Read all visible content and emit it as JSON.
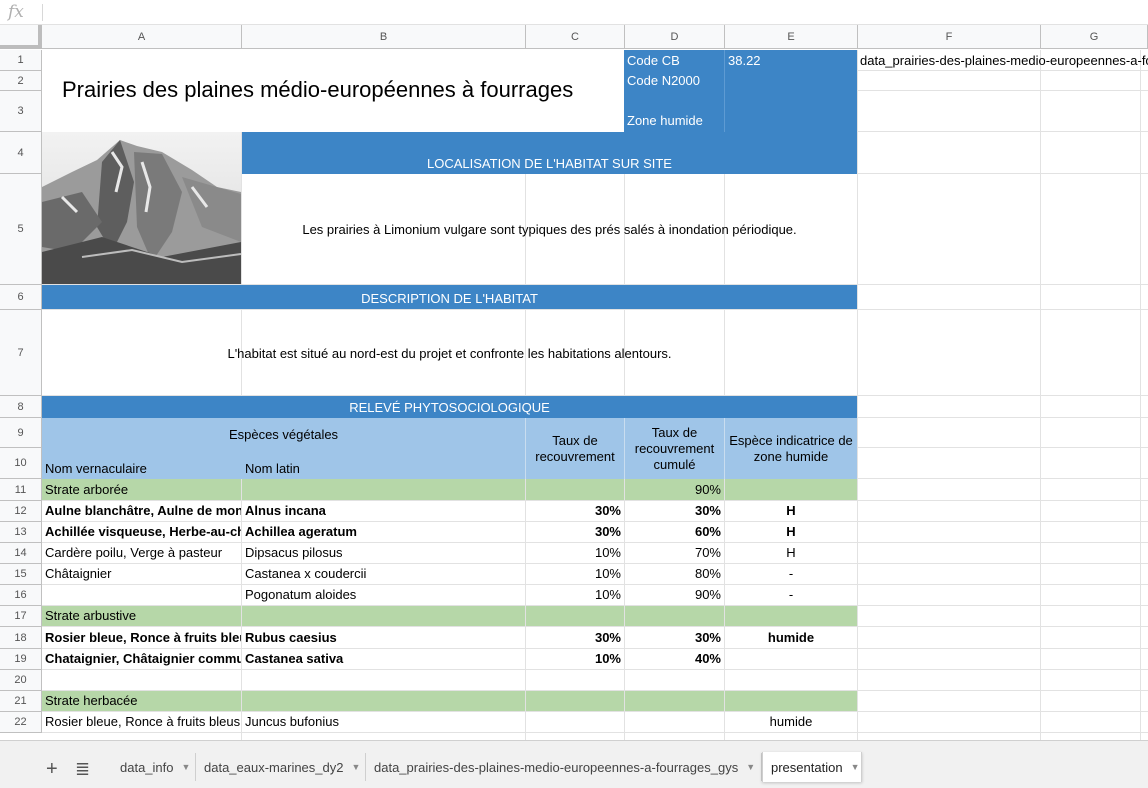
{
  "formula_bar": {
    "fx_label": "fx",
    "value": ""
  },
  "columns": [
    "A",
    "B",
    "C",
    "D",
    "E",
    "F",
    "G"
  ],
  "rows": [
    "1",
    "2",
    "3",
    "4",
    "5",
    "6",
    "7",
    "8",
    "9",
    "10",
    "11",
    "12",
    "13",
    "14",
    "15",
    "16",
    "17",
    "18",
    "19",
    "20",
    "21",
    "22"
  ],
  "header_block": {
    "title": "Prairies des plaines médio-européennes à fourrages",
    "code_cb_label": "Code CB",
    "code_cb_value": "38.22",
    "code_n2000_label": "Code N2000",
    "zone_humide_label": "Zone humide",
    "f1_value": "data_prairies-des-plaines-medio-europeennes-a-fourrages_gys"
  },
  "localisation": {
    "title": "LOCALISATION DE L'HABITAT SUR SITE",
    "text": "Les prairies à Limonium vulgare sont typiques des prés salés à inondation périodique."
  },
  "description": {
    "title": "DESCRIPTION DE L'HABITAT",
    "text": "L'habitat est situé au nord-est du projet et confronte les habitations alentours."
  },
  "releve": {
    "title": "RELEVÉ PHYTOSOCIOLOGIQUE",
    "especes_label": "Espèces végétales",
    "nom_vernaculaire": "Nom vernaculaire",
    "nom_latin": "Nom latin",
    "taux_recouvrement": "Taux de recouvrement",
    "taux_cumule": "Taux de recouvrement cumulé",
    "indicatrice": "Espèce indicatrice de zone humide"
  },
  "table_rows": [
    {
      "row": "11",
      "kind": "strate",
      "a": "Strate arborée",
      "b": "",
      "c": "",
      "d": "90%",
      "e": ""
    },
    {
      "row": "12",
      "kind": "bold",
      "a": "Aulne blanchâtre, Aulne de montagne",
      "b": "Alnus incana",
      "c": "30%",
      "d": "30%",
      "e": "H"
    },
    {
      "row": "13",
      "kind": "bold",
      "a": "Achillée visqueuse, Herbe-au-charpentier",
      "b": "Achillea ageratum",
      "c": "30%",
      "d": "60%",
      "e": "H"
    },
    {
      "row": "14",
      "kind": "normal",
      "a": "Cardère poilu, Verge à pasteur",
      "b": "Dipsacus pilosus",
      "c": "10%",
      "d": "70%",
      "e": "H"
    },
    {
      "row": "15",
      "kind": "normal",
      "a": "Châtaignier",
      "b": "Castanea x coudercii",
      "c": "10%",
      "d": "80%",
      "e": "-"
    },
    {
      "row": "16",
      "kind": "normal",
      "a": "",
      "b": "Pogonatum aloides",
      "c": "10%",
      "d": "90%",
      "e": "-"
    },
    {
      "row": "17",
      "kind": "strate",
      "a": "Strate arbustive",
      "b": "",
      "c": "",
      "d": "",
      "e": ""
    },
    {
      "row": "18",
      "kind": "bold",
      "a": "Rosier bleue, Ronce à fruits bleus",
      "b": "Rubus caesius",
      "c": "30%",
      "d": "30%",
      "e": "humide"
    },
    {
      "row": "19",
      "kind": "bold",
      "a": "Chataignier, Châtaignier commun",
      "b": "Castanea sativa",
      "c": "10%",
      "d": "40%",
      "e": ""
    },
    {
      "row": "20",
      "kind": "normal",
      "a": "",
      "b": "",
      "c": "",
      "d": "",
      "e": ""
    },
    {
      "row": "21",
      "kind": "strate",
      "a": "Strate herbacée",
      "b": "",
      "c": "",
      "d": "",
      "e": ""
    },
    {
      "row": "22",
      "kind": "normal",
      "a": "Rosier bleue, Ronce à fruits bleus,",
      "b": "Juncus bufonius",
      "c": "",
      "d": "",
      "e": "humide"
    }
  ],
  "image": {
    "alt_icon": "mountain-photo"
  },
  "tabs": [
    {
      "label": "data_info",
      "active": false
    },
    {
      "label": "data_eaux-marines_dy2",
      "active": false
    },
    {
      "label": "data_prairies-des-plaines-medio-europeennes-a-fourrages_gys",
      "active": false
    },
    {
      "label": "presentation",
      "active": true
    }
  ],
  "tabbar": {
    "add_icon": "+",
    "list_icon": "≣"
  },
  "colors": {
    "header_blue": "#3d85c6",
    "light_blue": "#9fc5e8",
    "strate_green": "#b6d7a8"
  }
}
